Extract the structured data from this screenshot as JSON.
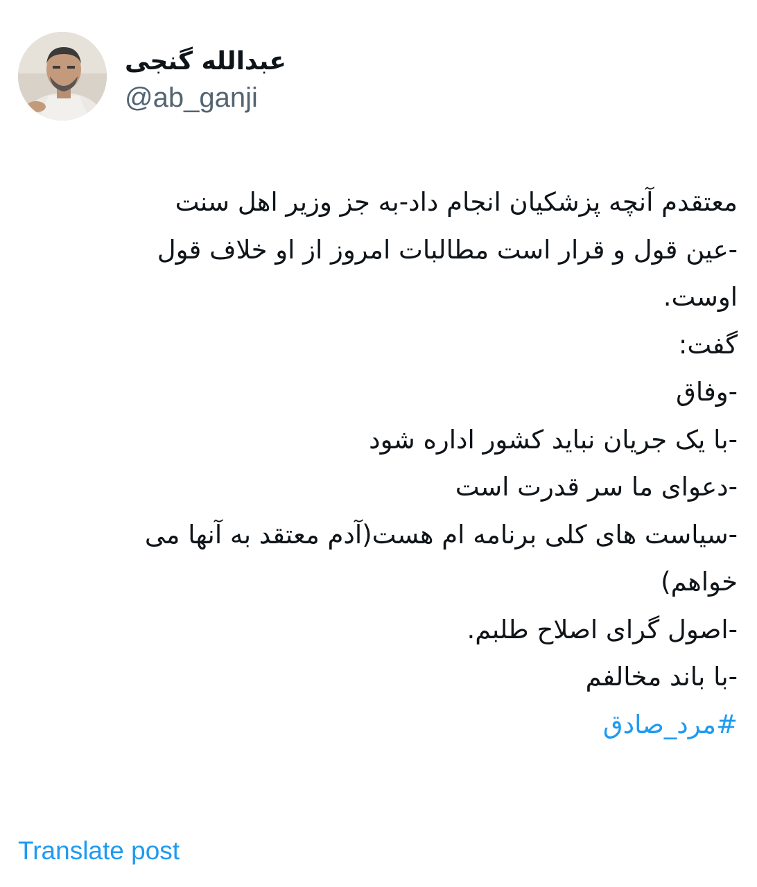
{
  "author": {
    "display_name": "عبدالله گنجی",
    "handle": "@ab_ganji",
    "avatar": "profile-photo"
  },
  "tweet": {
    "lines": [
      "معتقدم آنچه پزشکیان انجام داد-به جز وزیر اهل سنت",
      "-عین قول و قرار است مطالبات امروز از او خلاف قول",
      "اوست.",
      "گفت:",
      "-وفاق",
      "-با یک جریان نباید کشور اداره شود",
      "-دعوای ما سر قدرت است",
      "-سیاست های کلی برنامه ام هست(آدم معتقد به آنها می",
      "خواهم)",
      "-اصول گرای اصلاح طلبم.",
      "-با باند مخالفم"
    ],
    "hashtag": "#مرد_صادق"
  },
  "actions": {
    "translate_label": "Translate post"
  },
  "colors": {
    "text": "#0f1419",
    "secondary": "#536471",
    "link": "#1d9bf0",
    "background": "#ffffff"
  }
}
